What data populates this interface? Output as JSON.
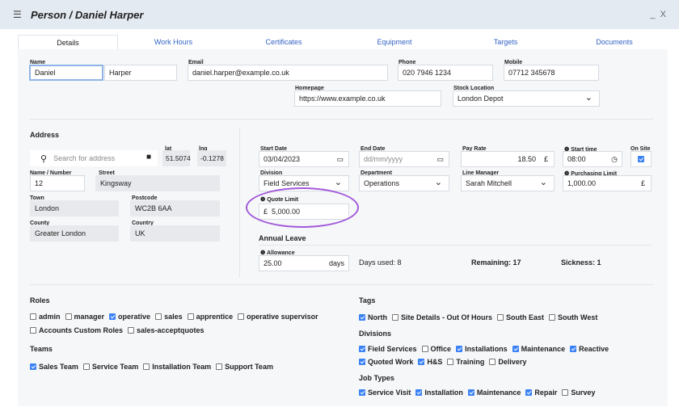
{
  "window": {
    "title": "Person / Daniel Harper",
    "menu_icon": "hamburger-icon",
    "minimize": "_",
    "close": "X"
  },
  "tabs": [
    "Details",
    "Work Hours",
    "Certificates",
    "Equipment",
    "Targets",
    "Documents"
  ],
  "name": {
    "label": "Name",
    "first": "Daniel",
    "last": "Harper"
  },
  "email": {
    "label": "Email",
    "value": "daniel.harper@example.co.uk"
  },
  "phone": {
    "label": "Phone",
    "value": "020 7946 1234"
  },
  "mobile": {
    "label": "Mobile",
    "value": "07712 345678"
  },
  "homepage": {
    "label": "Homepage",
    "value": "https://www.example.co.uk"
  },
  "stock": {
    "label": "Stock Location",
    "value": "London Depot"
  },
  "address": {
    "heading": "Address",
    "search_placeholder": "Search for address",
    "lat_label": "lat",
    "lat": "51.5074",
    "lng_label": "lng",
    "lng": "-0.1278",
    "num_label": "Name / Number",
    "num": "12",
    "street_label": "Street",
    "street": "Kingsway",
    "town_label": "Town",
    "town": "London",
    "postcode_label": "Postcode",
    "postcode": "WC2B 6AA",
    "county_label": "County",
    "county": "Greater London",
    "country_label": "Country",
    "country": "UK"
  },
  "job": {
    "start_date_label": "Start Date",
    "start_date": "03/04/2023",
    "end_date_label": "End Date",
    "end_date_placeholder": "dd/mm/yyyy",
    "pay_label": "Pay Rate",
    "pay": "18.50",
    "currency": "£",
    "start_time_label": "Start time",
    "start_time": "08:00",
    "onsite_label": "On Site",
    "division_label": "Division",
    "division": "Field Services",
    "department_label": "Department",
    "department": "Operations",
    "manager_label": "Line Manager",
    "manager": "Sarah Mitchell",
    "purch_label": "Purchasing Limit",
    "purch": "1,000.00",
    "quote_label": "Quote Limit",
    "quote": "5,000.00"
  },
  "leave": {
    "heading": "Annual Leave",
    "allowance_label": "Allowance",
    "allowance": "25.00",
    "unit": "days",
    "used": "Days used: 8",
    "remaining": "Remaining: 17",
    "sickness": "Sickness: 1"
  },
  "roles": {
    "heading": "Roles",
    "items": [
      {
        "label": "admin",
        "on": false
      },
      {
        "label": "manager",
        "on": false
      },
      {
        "label": "operative",
        "on": true
      },
      {
        "label": "sales",
        "on": false
      },
      {
        "label": "apprentice",
        "on": false
      },
      {
        "label": "operative supervisor",
        "on": false
      },
      {
        "label": "Accounts Custom Roles",
        "on": false
      },
      {
        "label": "sales-acceptquotes",
        "on": false
      }
    ]
  },
  "teams": {
    "heading": "Teams",
    "items": [
      {
        "label": "Sales Team",
        "on": true
      },
      {
        "label": "Service Team",
        "on": false
      },
      {
        "label": "Installation Team",
        "on": false
      },
      {
        "label": "Support Team",
        "on": false
      }
    ]
  },
  "tags": {
    "heading": "Tags",
    "items": [
      {
        "label": "North",
        "on": true
      },
      {
        "label": "Site Details - Out Of Hours",
        "on": false
      },
      {
        "label": "South East",
        "on": false
      },
      {
        "label": "South West",
        "on": false
      }
    ]
  },
  "divisions": {
    "heading": "Divisions",
    "items": [
      {
        "label": "Field Services",
        "on": true
      },
      {
        "label": "Office",
        "on": false
      },
      {
        "label": "Installations",
        "on": true
      },
      {
        "label": "Maintenance",
        "on": true
      },
      {
        "label": "Reactive",
        "on": true
      },
      {
        "label": "Quoted Work",
        "on": true
      },
      {
        "label": "H&S",
        "on": true
      },
      {
        "label": "Training",
        "on": false
      },
      {
        "label": "Delivery",
        "on": false
      }
    ]
  },
  "jobtypes": {
    "heading": "Job Types",
    "items": [
      {
        "label": "Service Visit",
        "on": true
      },
      {
        "label": "Installation",
        "on": true
      },
      {
        "label": "Maintenance",
        "on": true
      },
      {
        "label": "Repair",
        "on": true
      },
      {
        "label": "Survey",
        "on": false
      }
    ]
  },
  "colors": {
    "accent": "#3b82f6",
    "highlight_ring": "#a259d9",
    "titlebar": "#e3eaf2"
  }
}
